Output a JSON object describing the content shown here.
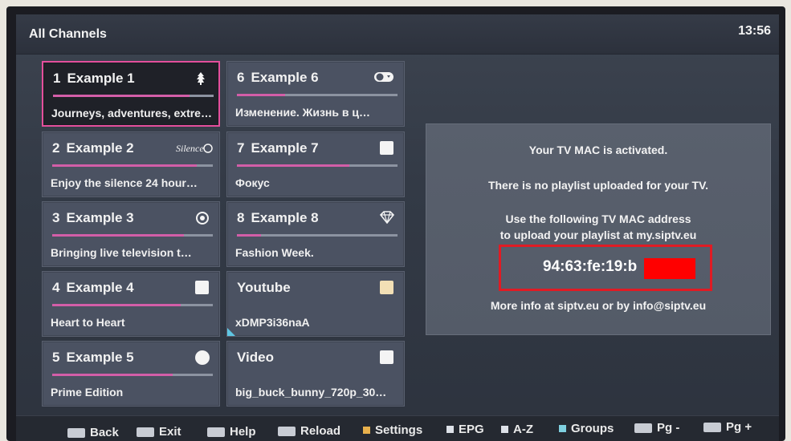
{
  "header": {
    "title": "All Channels",
    "clock": "13:56"
  },
  "channels": [
    {
      "num": "1",
      "name": "Example 1",
      "subtitle": "Journeys, adventures, extreme",
      "progress": 0.85,
      "icon": "plant-icon",
      "selected": true
    },
    {
      "num": "2",
      "name": "Example 2",
      "subtitle": "Enjoy the silence 24 hour…",
      "progress": 0.9,
      "icon": "silence-logo-icon"
    },
    {
      "num": "3",
      "name": "Example 3",
      "subtitle": "Bringing live television t…",
      "progress": 0.82,
      "icon": "gear-circle-icon"
    },
    {
      "num": "4",
      "name": "Example 4",
      "subtitle": "Heart to Heart",
      "progress": 0.8,
      "icon": "square-icon"
    },
    {
      "num": "5",
      "name": "Example 5",
      "subtitle": "Prime Edition",
      "progress": 0.75,
      "icon": "circle-icon"
    },
    {
      "num": "6",
      "name": "Example 6",
      "subtitle": "Изменение. Жизнь в ц…",
      "progress": 0.3,
      "icon": "toggle-icon"
    },
    {
      "num": "7",
      "name": "Example 7",
      "subtitle": "Фокус",
      "progress": 0.7,
      "icon": "square-icon"
    },
    {
      "num": "8",
      "name": "Example 8",
      "subtitle": "Fashion Week.",
      "progress": 0.15,
      "icon": "diamond-icon"
    },
    {
      "num": "",
      "name": "Youtube",
      "subtitle": "xDMP3i36naA",
      "progress": 0,
      "icon": "square-icon"
    },
    {
      "num": "",
      "name": "Video",
      "subtitle": "big_buck_bunny_720p_30…",
      "progress": 0,
      "icon": "square-icon"
    }
  ],
  "panel": {
    "line1": "Your TV MAC is activated.",
    "line2": "There is no playlist uploaded for your TV.",
    "line3": "Use the following TV MAC address",
    "line4": "to upload your playlist at my.siptv.eu",
    "mac": "94:63:fe:19:b",
    "line5": "More info at siptv.eu or by info@siptv.eu"
  },
  "footer": {
    "back": "Back",
    "exit": "Exit",
    "help": "Help",
    "reload": "Reload",
    "settings": "Settings",
    "epg": "EPG",
    "az": "A-Z",
    "groups": "Groups",
    "pgdown": "Pg -",
    "pgup": "Pg +"
  },
  "colors": {
    "accent": "#e44f9c",
    "settings": "#e8b04c",
    "groups": "#7fd0e0",
    "highlight": "#e01b24"
  }
}
